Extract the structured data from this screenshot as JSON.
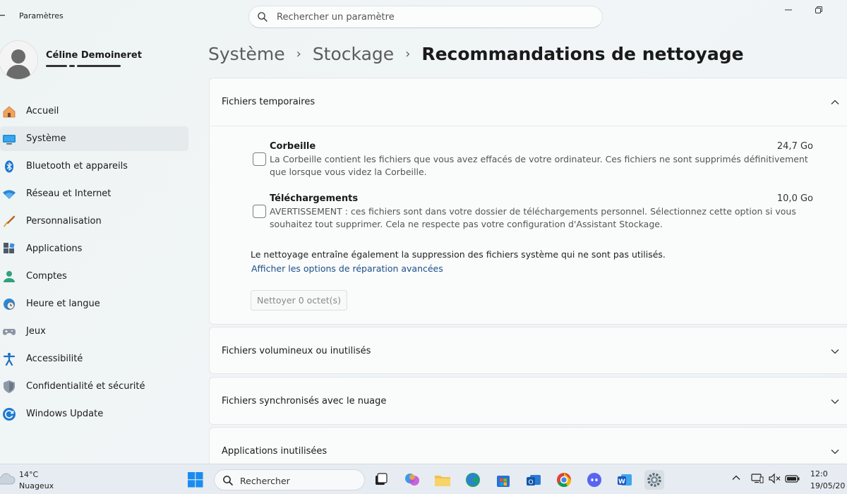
{
  "window": {
    "title": "Paramètres"
  },
  "search": {
    "placeholder": "Rechercher un paramètre"
  },
  "user": {
    "name": "Céline Demoineret"
  },
  "sidebar": {
    "items": [
      {
        "label": "Accueil",
        "icon": "home-icon"
      },
      {
        "label": "Système",
        "icon": "monitor-icon",
        "active": true
      },
      {
        "label": "Bluetooth et appareils",
        "icon": "bluetooth-icon"
      },
      {
        "label": "Réseau et Internet",
        "icon": "wifi-icon"
      },
      {
        "label": "Personnalisation",
        "icon": "brush-icon"
      },
      {
        "label": "Applications",
        "icon": "apps-icon"
      },
      {
        "label": "Comptes",
        "icon": "person-icon"
      },
      {
        "label": "Heure et langue",
        "icon": "clock-globe-icon"
      },
      {
        "label": "Jeux",
        "icon": "gamepad-icon"
      },
      {
        "label": "Accessibilité",
        "icon": "accessibility-icon"
      },
      {
        "label": "Confidentialité et sécurité",
        "icon": "shield-icon"
      },
      {
        "label": "Windows Update",
        "icon": "update-icon"
      }
    ]
  },
  "breadcrumb": {
    "level1": "Système",
    "level2": "Stockage",
    "current": "Recommandations de nettoyage"
  },
  "sections": {
    "temp": {
      "title": "Fichiers temporaires",
      "items": [
        {
          "title": "Corbeille",
          "size": "24,7 Go",
          "desc": "La Corbeille contient les fichiers que vous avez effacés de votre ordinateur. Ces fichiers ne sont supprimés définitivement que lorsque vous videz la Corbeille.",
          "checked": false
        },
        {
          "title": "Téléchargements",
          "size": "10,0 Go",
          "desc": "AVERTISSEMENT : ces fichiers sont dans votre dossier de téléchargements personnel. Sélectionnez cette option si vous souhaitez tout supprimer. Cela ne respecte pas votre configuration d'Assistant Stockage.",
          "checked": false
        }
      ],
      "note": "Le nettoyage entraîne également la suppression des fichiers système qui ne sont pas utilisés.",
      "link": "Afficher les options de réparation avancées",
      "button": "Nettoyer 0 octet(s)"
    },
    "large": {
      "title": "Fichiers volumineux ou inutilisés"
    },
    "cloud": {
      "title": "Fichiers synchronisés avec le nuage"
    },
    "unused_apps": {
      "title": "Applications inutilisées"
    }
  },
  "taskbar": {
    "weather": {
      "temp": "14°C",
      "desc": "Nuageux"
    },
    "search_label": "Rechercher",
    "clock": {
      "time": "12:0",
      "date": "19/05/20"
    }
  },
  "colors": {
    "accent": "#0067c0",
    "link": "#1b4e8a"
  }
}
